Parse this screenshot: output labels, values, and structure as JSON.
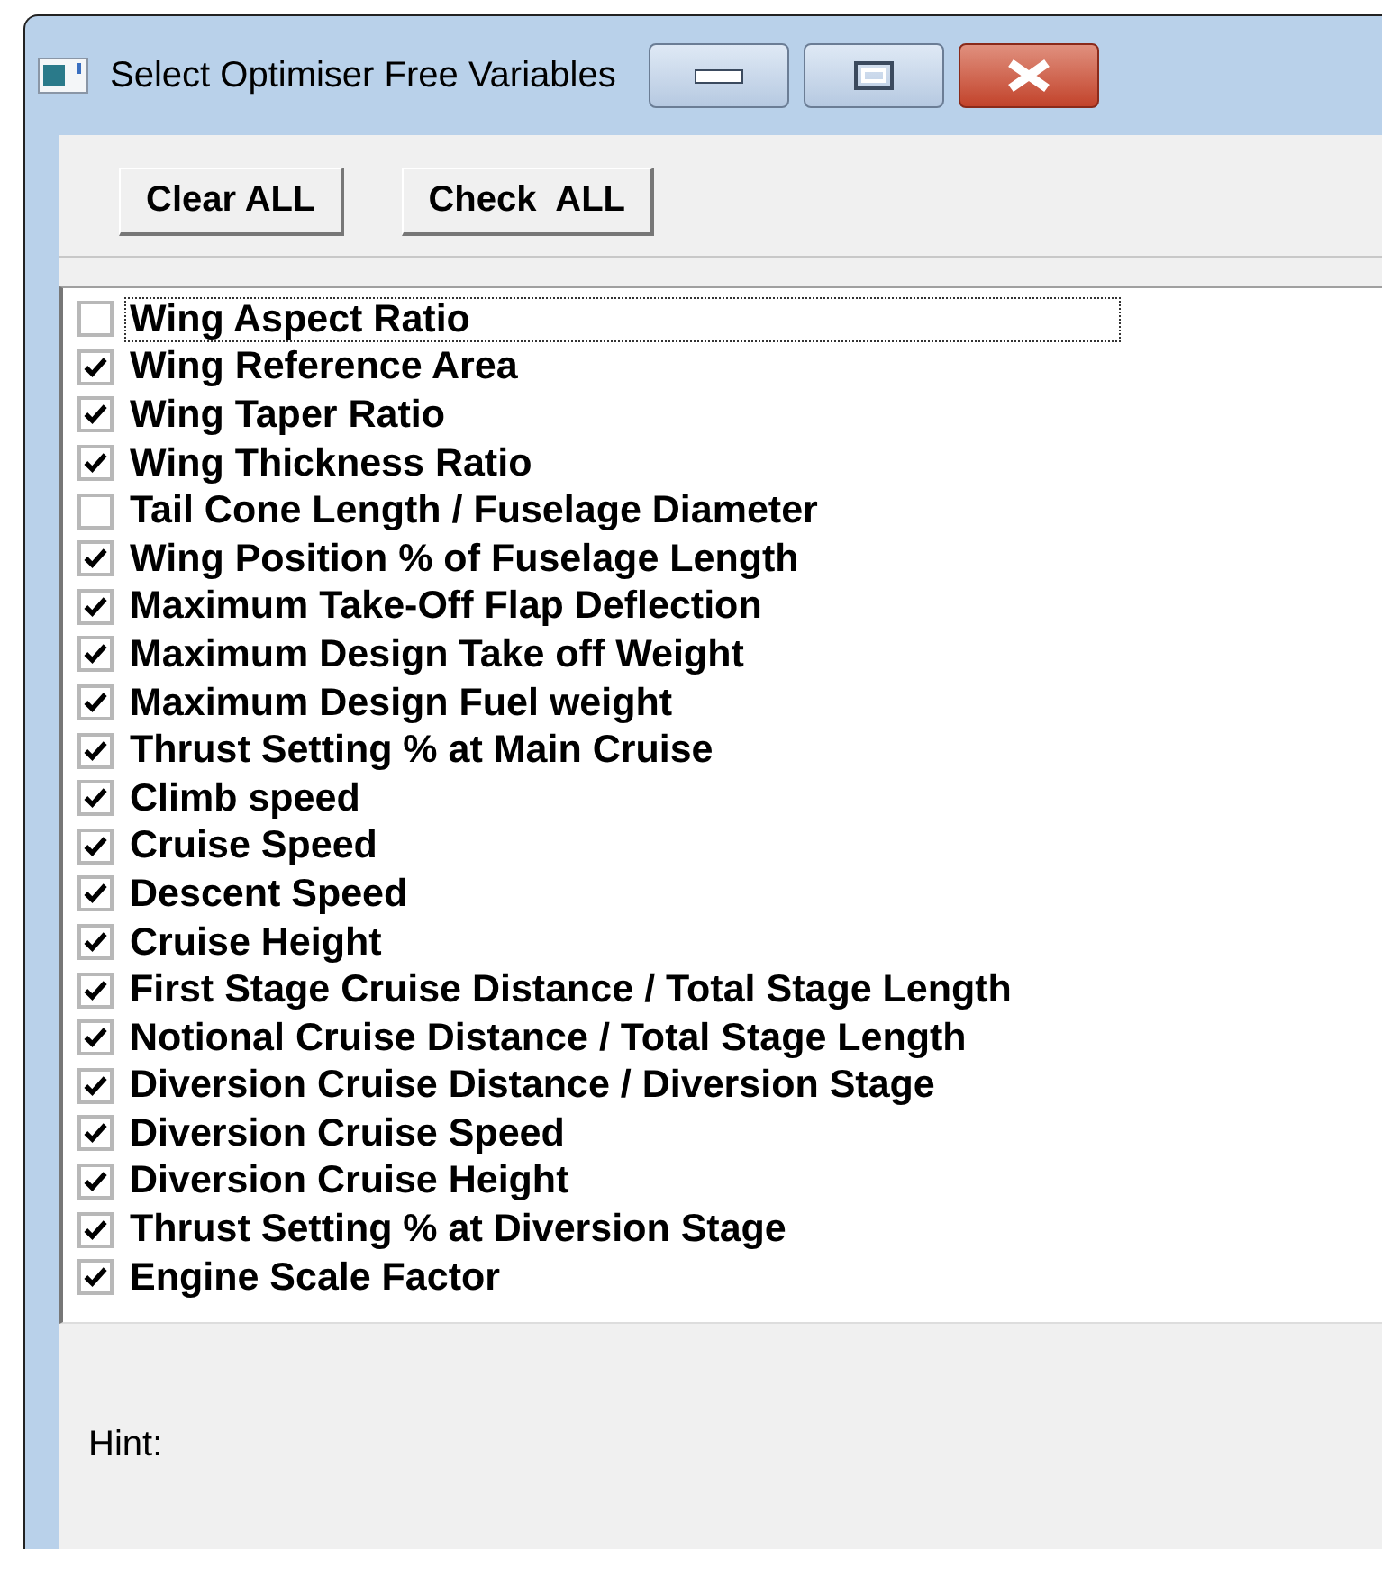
{
  "window": {
    "title": "Select Optimiser Free Variables"
  },
  "buttons": [
    {
      "label": "Clear ALL"
    },
    {
      "label": "Check  ALL"
    }
  ],
  "variables": [
    {
      "label": "Wing Aspect Ratio",
      "checked": false,
      "focused": true
    },
    {
      "label": "Wing Reference Area",
      "checked": true,
      "focused": false
    },
    {
      "label": "Wing Taper Ratio",
      "checked": true,
      "focused": false
    },
    {
      "label": "Wing Thickness Ratio",
      "checked": true,
      "focused": false
    },
    {
      "label": "Tail Cone Length / Fuselage Diameter",
      "checked": false,
      "focused": false
    },
    {
      "label": "Wing Position % of Fuselage Length",
      "checked": true,
      "focused": false
    },
    {
      "label": "Maximum Take-Off Flap Deflection",
      "checked": true,
      "focused": false
    },
    {
      "label": "Maximum Design Take off Weight",
      "checked": true,
      "focused": false
    },
    {
      "label": "Maximum Design Fuel weight",
      "checked": true,
      "focused": false
    },
    {
      "label": "Thrust Setting % at Main Cruise",
      "checked": true,
      "focused": false
    },
    {
      "label": "Climb speed",
      "checked": true,
      "focused": false
    },
    {
      "label": "Cruise Speed",
      "checked": true,
      "focused": false
    },
    {
      "label": "Descent Speed",
      "checked": true,
      "focused": false
    },
    {
      "label": "Cruise Height",
      "checked": true,
      "focused": false
    },
    {
      "label": "First Stage Cruise Distance / Total Stage Length",
      "checked": true,
      "focused": false
    },
    {
      "label": "Notional Cruise Distance / Total Stage Length",
      "checked": true,
      "focused": false
    },
    {
      "label": "Diversion Cruise Distance / Diversion Stage",
      "checked": true,
      "focused": false
    },
    {
      "label": "Diversion Cruise Speed",
      "checked": true,
      "focused": false
    },
    {
      "label": "Diversion Cruise Height",
      "checked": true,
      "focused": false
    },
    {
      "label": "Thrust Setting % at Diversion Stage",
      "checked": true,
      "focused": false
    },
    {
      "label": "Engine Scale Factor",
      "checked": true,
      "focused": false
    }
  ],
  "hint": {
    "label": "Hint:"
  }
}
